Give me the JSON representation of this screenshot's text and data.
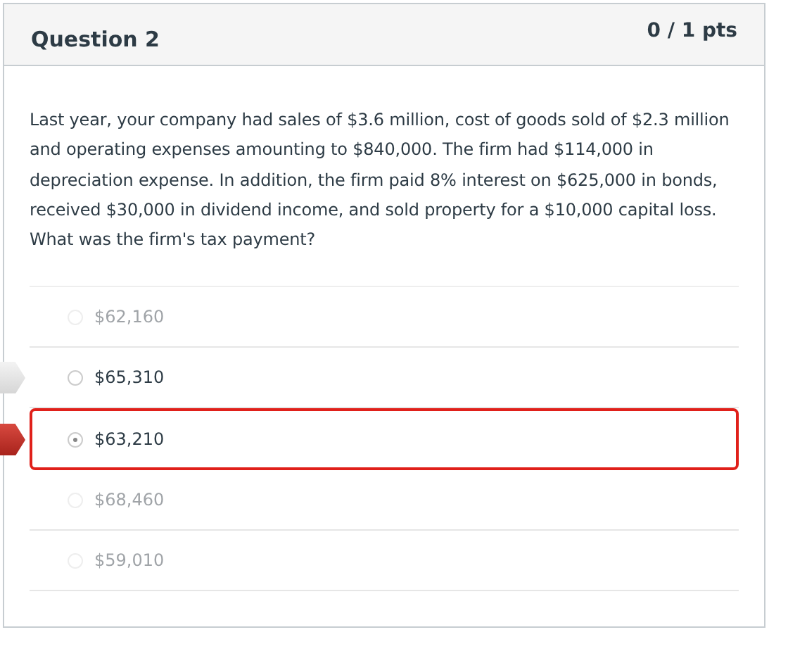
{
  "question": {
    "title": "Question 2",
    "points": "0 / 1 pts",
    "text": "Last year, your company had sales of $3.6 million, cost of goods sold of $2.3 million and operating expenses amounting to $840,000. The firm had $114,000 in depreciation expense. In addition, the firm paid 8% interest on $625,000 in bonds, received $30,000 in dividend income, and sold property for a $10,000 capital loss. What was the firm's tax payment?"
  },
  "answers": [
    {
      "label": "$62,160",
      "selected": false,
      "dimmed": true,
      "correct": false
    },
    {
      "label": "$65,310",
      "selected": false,
      "dimmed": false,
      "correct": true
    },
    {
      "label": "$63,210",
      "selected": true,
      "dimmed": false,
      "correct": false
    },
    {
      "label": "$68,460",
      "selected": false,
      "dimmed": true,
      "correct": false
    },
    {
      "label": "$59,010",
      "selected": false,
      "dimmed": true,
      "correct": false
    }
  ]
}
